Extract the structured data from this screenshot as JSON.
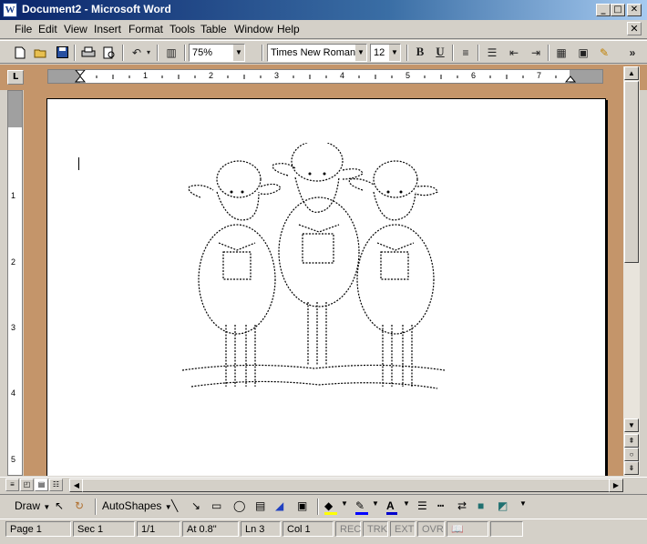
{
  "window": {
    "title": "Document2 - Microsoft Word",
    "icon_letter": "W"
  },
  "caption_buttons": {
    "minimize": "_",
    "maximize": "□",
    "close": "✕"
  },
  "menu": [
    "File",
    "Edit",
    "View",
    "Insert",
    "Format",
    "Tools",
    "Table",
    "Window",
    "Help"
  ],
  "doc_close": "✕",
  "toolbar": {
    "zoom": "75%",
    "font": "Times New Roman",
    "size": "12",
    "bold": "B",
    "underline": "U",
    "more": "»"
  },
  "ruler": {
    "tab_selector": "L",
    "h_numbers": [
      "1",
      "2",
      "3",
      "4",
      "5",
      "6",
      "7"
    ],
    "v_numbers": [
      "1",
      "2",
      "3",
      "4",
      "5"
    ]
  },
  "drawing": {
    "draw_label": "Draw",
    "autoshapes_label": "AutoShapes",
    "fill_color": "#ffff00",
    "line_color": "#0000ff",
    "font_color": "#0000cc"
  },
  "status": {
    "page": "Page  1",
    "sec": "Sec  1",
    "pages": "1/1",
    "at": "At  0.8\"",
    "ln": "Ln  3",
    "col": "Col  1",
    "rec": "REC",
    "trk": "TRK",
    "ext": "EXT",
    "ovr": "OVR"
  },
  "colors": {
    "workspace": "#c4956a",
    "title_bar": "#0a246a"
  }
}
